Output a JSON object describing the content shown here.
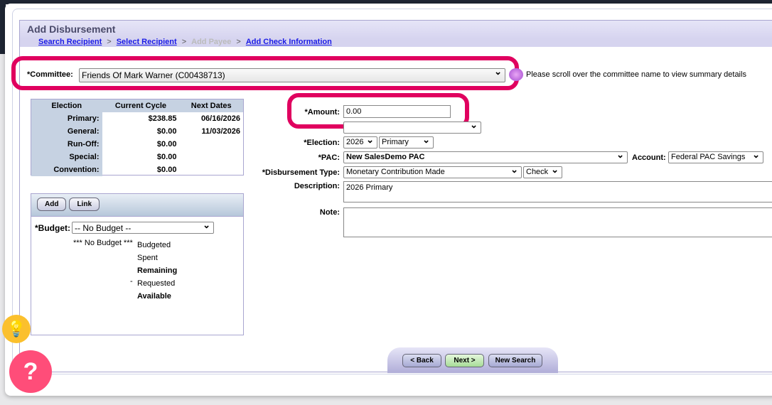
{
  "header": {
    "title": "Add Disbursement"
  },
  "breadcrumb": [
    {
      "label": "Search Recipient"
    },
    {
      "label": "Select Recipient"
    },
    {
      "label": "Add Payee"
    },
    {
      "label": "Add Check Information"
    }
  ],
  "committee": {
    "label": "*Committee:",
    "value": "Friends Of Mark Warner (C00438713)",
    "hint": "Please scroll over the committee name to view summary details"
  },
  "stats": {
    "headers": [
      "Election",
      "Current Cycle",
      "Next Dates"
    ],
    "rows": [
      [
        "Primary:",
        "$238.85",
        "06/16/2026"
      ],
      [
        "General:",
        "$0.00",
        "11/03/2026"
      ],
      [
        "Run-Off:",
        "$0.00",
        ""
      ],
      [
        "Special:",
        "$0.00",
        ""
      ],
      [
        "Convention:",
        "$0.00",
        ""
      ]
    ]
  },
  "budget": {
    "add_label": "Add",
    "link_label": "Link",
    "label": "*Budget:",
    "value": "-- No Budget --",
    "name": "*** No Budget ***",
    "items": [
      "Budgeted",
      "Spent",
      "Remaining",
      "Requested",
      "Available"
    ],
    "requested_prefix": "-"
  },
  "form": {
    "amount_label": "*Amount:",
    "amount_value": "0.00",
    "election_label": "*Election:",
    "election_year": "2026",
    "election_type": "Primary",
    "pac_label": "*PAC:",
    "pac_value": "New SalesDemo PAC",
    "account_label": "Account:",
    "account_value": "Federal PAC Savings",
    "type_label": "*Disbursement Type:",
    "type_value": "Monetary Contribution Made",
    "method_value": "Check",
    "description_label": "Description:",
    "description_value": "2026 Primary",
    "note_label": "Note:",
    "note_value": ""
  },
  "nav": {
    "back": "< Back",
    "next": "Next >",
    "new_search": "New Search"
  },
  "colors": {
    "highlight": "#e0005f",
    "link": "#1a1ae6"
  }
}
